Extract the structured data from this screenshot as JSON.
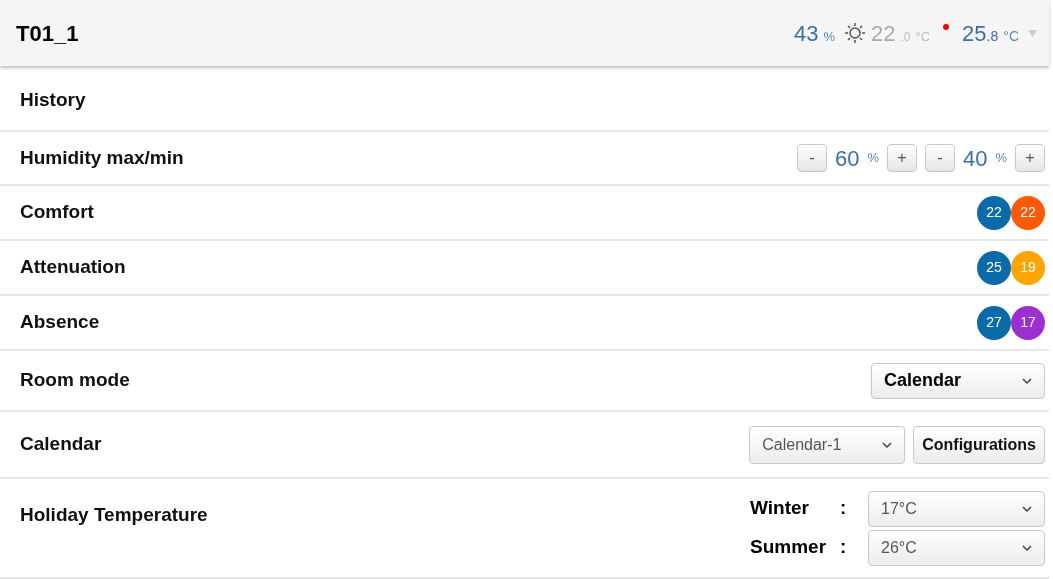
{
  "header": {
    "title": "T01_1",
    "humidity": "43",
    "humidity_unit": "%",
    "outdoor": "22",
    "outdoor_decimal": ".0",
    "outdoor_unit": "°C",
    "indoor": "25",
    "indoor_decimal": ".8",
    "indoor_unit": "°C"
  },
  "rows": [
    {
      "kind": "plain",
      "label": "History"
    },
    {
      "kind": "humidity",
      "label": "Humidity max/min",
      "controls": [
        {
          "minus": "-",
          "value": "60",
          "unit": "%",
          "plus": "+"
        },
        {
          "minus": "-",
          "value": "40",
          "unit": "%",
          "plus": "+"
        }
      ]
    },
    {
      "kind": "setpoints",
      "label": "Comfort",
      "dots": [
        {
          "value": "22",
          "color": "#0b6aa8"
        },
        {
          "value": "22",
          "color": "#ff5a00"
        }
      ]
    },
    {
      "kind": "setpoints",
      "label": "Attenuation",
      "dots": [
        {
          "value": "25",
          "color": "#0b6aa8"
        },
        {
          "value": "19",
          "color": "#ffa500"
        }
      ]
    },
    {
      "kind": "setpoints",
      "label": "Absence",
      "dots": [
        {
          "value": "27",
          "color": "#0b6aa8"
        },
        {
          "value": "17",
          "color": "#9b30d0"
        }
      ]
    },
    {
      "kind": "select",
      "label": "Room mode",
      "value": "Calendar"
    },
    {
      "kind": "calendar",
      "label": "Calendar",
      "value": "Calendar-1",
      "button": "Configurations"
    },
    {
      "kind": "holiday",
      "label": "Holiday Temperature",
      "seasons": [
        {
          "name": "Winter",
          "sep": ":",
          "value": "17°C"
        },
        {
          "name": "Summer",
          "sep": ":",
          "value": "26°C"
        }
      ]
    }
  ]
}
